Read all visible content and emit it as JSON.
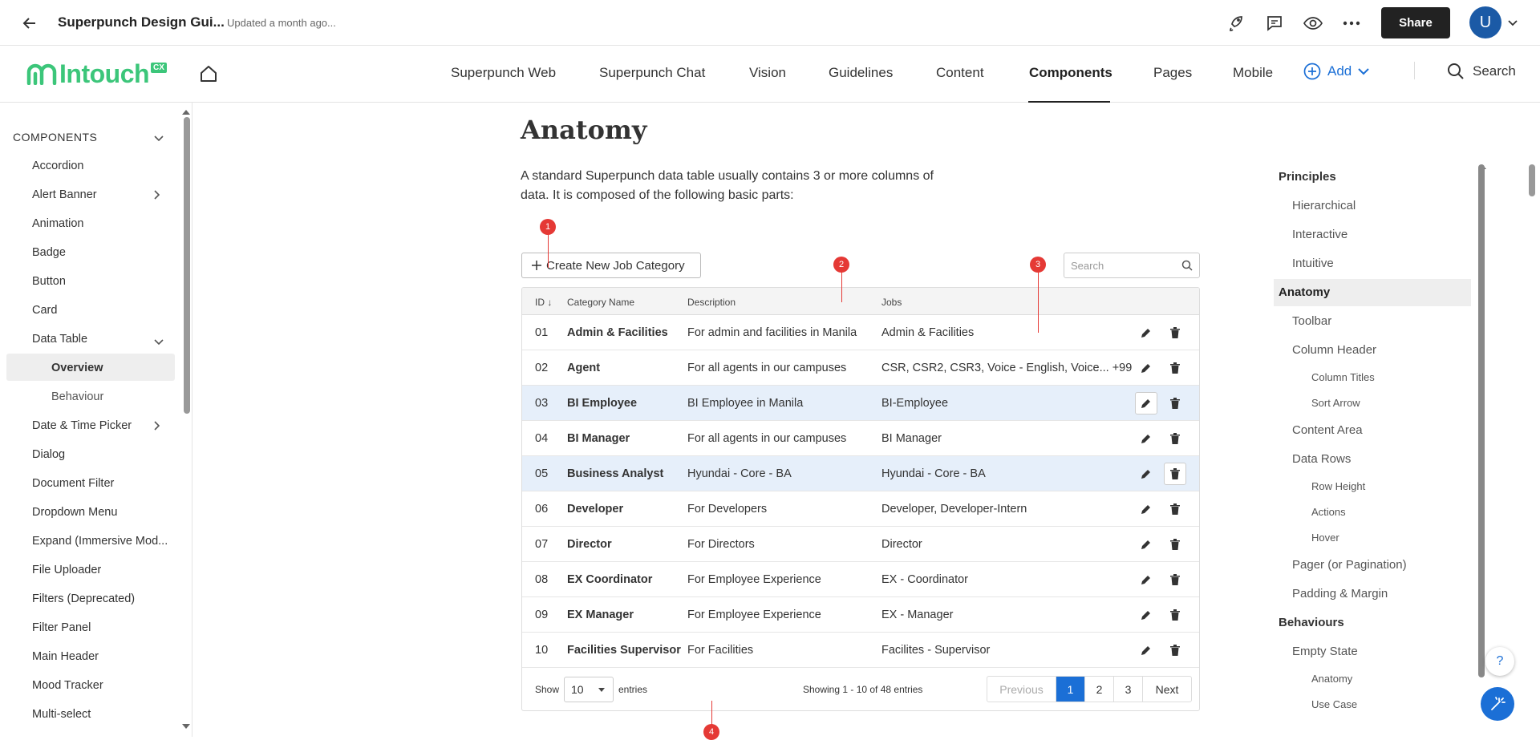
{
  "topbar": {
    "title": "Superpunch Design Gui...",
    "updated": "Updated a month ago...",
    "share_label": "Share",
    "avatar_initial": "U"
  },
  "logo": {
    "word": "Intouch",
    "badge": "CX"
  },
  "nav": {
    "items": [
      "Superpunch Web",
      "Superpunch Chat",
      "Vision",
      "Guidelines",
      "Content",
      "Components",
      "Pages",
      "Mobile"
    ],
    "active": "Components",
    "add_label": "Add",
    "search_label": "Search"
  },
  "sidebar": {
    "heading": "COMPONENTS",
    "items": [
      "Accordion",
      "Alert Banner",
      "Animation",
      "Badge",
      "Button",
      "Card",
      "Data Table",
      "Overview",
      "Behaviour",
      "Date & Time Picker",
      "Dialog",
      "Document Filter",
      "Dropdown Menu",
      "Expand (Immersive Mod...",
      "File Uploader",
      "Filters (Deprecated)",
      "Filter Panel",
      "Main Header",
      "Mood Tracker",
      "Multi-select"
    ],
    "selected": "Overview"
  },
  "main": {
    "title": "Anatomy",
    "intro": "A standard Superpunch data table usually contains 3 or more columns of data. It is composed of the following basic parts:",
    "markers": [
      "1",
      "2",
      "3",
      "4"
    ]
  },
  "table": {
    "create_label": "Create New Job Category",
    "search_placeholder": "Search",
    "headers": [
      "ID",
      "Category Name",
      "Description",
      "Jobs"
    ],
    "rows": [
      {
        "id": "01",
        "name": "Admin & Facilities",
        "desc": "For admin and facilities in Manila",
        "jobs": "Admin & Facilities"
      },
      {
        "id": "02",
        "name": "Agent",
        "desc": "For all agents in our campuses",
        "jobs": "CSR, CSR2, CSR3, Voice - English, Voice... +99"
      },
      {
        "id": "03",
        "name": "BI Employee",
        "desc": "BI Employee in Manila",
        "jobs": "BI-Employee"
      },
      {
        "id": "04",
        "name": "BI Manager",
        "desc": "For all agents in our campuses",
        "jobs": "BI Manager"
      },
      {
        "id": "05",
        "name": "Business Analyst",
        "desc": "Hyundai - Core - BA",
        "jobs": "Hyundai - Core - BA"
      },
      {
        "id": "06",
        "name": "Developer",
        "desc": "For Developers",
        "jobs": "Developer, Developer-Intern"
      },
      {
        "id": "07",
        "name": "Director",
        "desc": "For Directors",
        "jobs": "Director"
      },
      {
        "id": "08",
        "name": "EX Coordinator",
        "desc": "For Employee Experience",
        "jobs": "EX - Coordinator"
      },
      {
        "id": "09",
        "name": "EX Manager",
        "desc": "For Employee Experience",
        "jobs": "EX - Manager"
      },
      {
        "id": "10",
        "name": "Facilities Supervisor",
        "desc": "For Facilities",
        "jobs": "Facilites - Supervisor"
      }
    ],
    "footer": {
      "show": "Show",
      "page_size": "10",
      "entries": "entries",
      "showing": "Showing 1 - 10 of 48 entries",
      "previous": "Previous",
      "pages": [
        "1",
        "2",
        "3"
      ],
      "next": "Next"
    }
  },
  "toc": {
    "items": [
      "Principles",
      "Hierarchical",
      "Interactive",
      "Intuitive",
      "Anatomy",
      "Toolbar",
      "Column Header",
      "Column Titles",
      "Sort Arrow",
      "Content Area",
      "Data Rows",
      "Row Height",
      "Actions",
      "Hover",
      "Pager (or Pagination)",
      "Padding & Margin",
      "Behaviours",
      "Empty State",
      "Anatomy",
      "Use Case"
    ],
    "active": "Anatomy"
  },
  "help_label": "?",
  "colors": {
    "accent": "#1b6fd6",
    "brand_green": "#3cc67a",
    "marker_red": "#e53935",
    "row_highlight": "#e6effa"
  }
}
